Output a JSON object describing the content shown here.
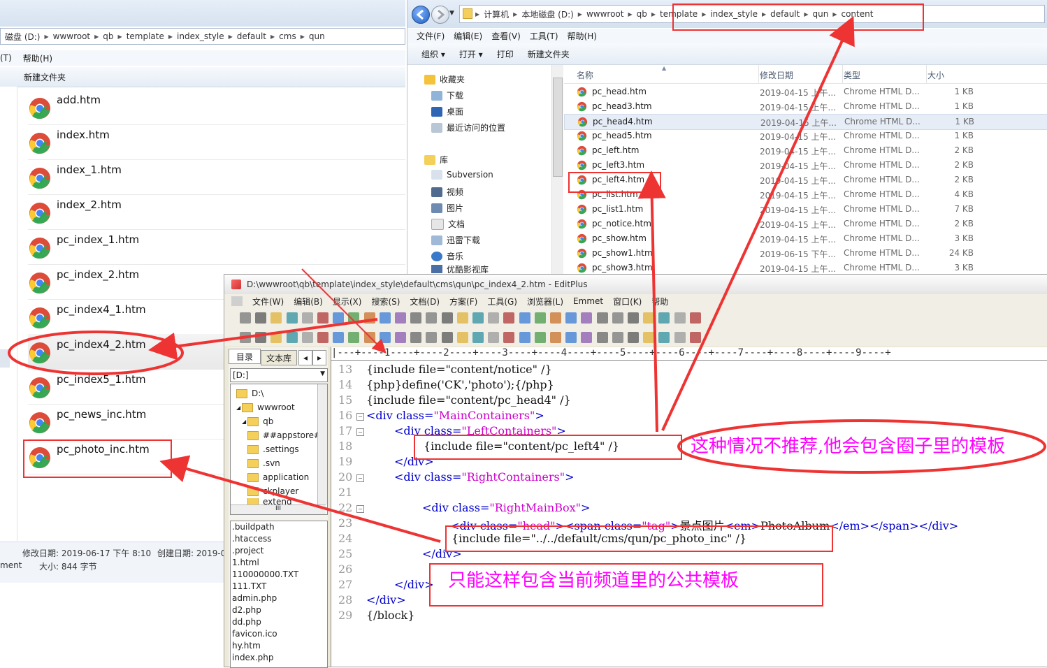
{
  "left_explorer": {
    "breadcrumb": [
      "磁盘 (D:)",
      "wwwroot",
      "qb",
      "template",
      "index_style",
      "default",
      "cms",
      "qun"
    ],
    "menu": [
      "(T)",
      "帮助(H)"
    ],
    "toolbar_new_folder": "新建文件夹",
    "files": [
      "add.htm",
      "index.htm",
      "index_1.htm",
      "index_2.htm",
      "pc_index_1.htm",
      "pc_index_2.htm",
      "pc_index4_1.htm",
      "pc_index4_2.htm",
      "pc_index5_1.htm",
      "pc_news_inc.htm",
      "pc_photo_inc.htm"
    ],
    "status": {
      "modified": "修改日期: 2019-06-17 下午 8:10",
      "created": "创建日期: 2019-0",
      "type": "ment",
      "size": "大小: 844 字节"
    }
  },
  "right_explorer": {
    "breadcrumb": [
      "计算机",
      "本地磁盘 (D:)",
      "wwwroot",
      "qb",
      "template",
      "index_style",
      "default",
      "qun",
      "content"
    ],
    "menu": [
      "文件(F)",
      "编辑(E)",
      "查看(V)",
      "工具(T)",
      "帮助(H)"
    ],
    "toolbar": [
      "组织 ▾",
      "打开 ▾",
      "打印",
      "新建文件夹"
    ],
    "nav": {
      "favorites": "收藏夹",
      "downloads": "下载",
      "desktop": "桌面",
      "recent": "最近访问的位置",
      "libraries": "库",
      "subversion": "Subversion",
      "video": "视频",
      "pictures": "图片",
      "documents": "文档",
      "thunder": "迅雷下载",
      "music": "音乐",
      "partial": "优酷影视库"
    },
    "columns": {
      "name": "名称",
      "date": "修改日期",
      "type": "类型",
      "size": "大小"
    },
    "rows": [
      {
        "name": "pc_head.htm",
        "date": "2019-04-15 上午...",
        "type": "Chrome HTML D...",
        "size": "1 KB"
      },
      {
        "name": "pc_head3.htm",
        "date": "2019-04-15 上午...",
        "type": "Chrome HTML D...",
        "size": "1 KB"
      },
      {
        "name": "pc_head4.htm",
        "date": "2019-04-15 上午...",
        "type": "Chrome HTML D...",
        "size": "1 KB"
      },
      {
        "name": "pc_head5.htm",
        "date": "2019-04-15 上午...",
        "type": "Chrome HTML D...",
        "size": "1 KB"
      },
      {
        "name": "pc_left.htm",
        "date": "2019-04-15 上午...",
        "type": "Chrome HTML D...",
        "size": "2 KB"
      },
      {
        "name": "pc_left3.htm",
        "date": "2019-04-15 上午...",
        "type": "Chrome HTML D...",
        "size": "2 KB"
      },
      {
        "name": "pc_left4.htm",
        "date": "2019-04-15 上午...",
        "type": "Chrome HTML D...",
        "size": "2 KB"
      },
      {
        "name": "pc_list.htm",
        "date": "2019-04-15 上午...",
        "type": "Chrome HTML D...",
        "size": "4 KB"
      },
      {
        "name": "pc_list1.htm",
        "date": "2019-04-15 上午...",
        "type": "Chrome HTML D...",
        "size": "7 KB"
      },
      {
        "name": "pc_notice.htm",
        "date": "2019-04-15 上午...",
        "type": "Chrome HTML D...",
        "size": "2 KB"
      },
      {
        "name": "pc_show.htm",
        "date": "2019-04-15 上午...",
        "type": "Chrome HTML D...",
        "size": "3 KB"
      },
      {
        "name": "pc_show1.htm",
        "date": "2019-06-15 下午...",
        "type": "Chrome HTML D...",
        "size": "24 KB"
      },
      {
        "name": "pc_show3.htm",
        "date": "2019-04-15 上午...",
        "type": "Chrome HTML D...",
        "size": "3 KB"
      }
    ]
  },
  "editplus": {
    "title": "D:\\wwwroot\\qb\\template\\index_style\\default\\cms\\qun\\pc_index4_2.htm - EditPlus",
    "menu": [
      "文件(W)",
      "编辑(B)",
      "显示(X)",
      "搜索(S)",
      "文档(D)",
      "方案(F)",
      "工具(G)",
      "浏览器(L)",
      "Emmet",
      "窗口(K)",
      "帮助"
    ],
    "tabs": {
      "dir": "目录",
      "lib": "文本库"
    },
    "drive": "[D:]",
    "tree": [
      "D:\\",
      "wwwroot",
      "qb",
      "##appstore#",
      ".settings",
      ".svn",
      "application",
      "ckplayer",
      "extend"
    ],
    "file_list": [
      ".buildpath",
      ".htaccess",
      ".project",
      "1.html",
      "110000000.TXT",
      "111.TXT",
      "admin.php",
      "d2.php",
      "dd.php",
      "favicon.ico",
      "hy.htm",
      "index.php"
    ],
    "ruler": "|---+----1----+----2----+----3----+----4----+----5----+----6----+----7----+----8----+----9----+",
    "line_numbers": [
      "13",
      "14",
      "15",
      "16",
      "17",
      "18",
      "19",
      "20",
      "21",
      "22",
      "23",
      "24",
      "25",
      "26",
      "27",
      "28",
      "29"
    ],
    "code": {
      "l13": "{include file=\"content/notice\" /}",
      "l14": "{php}define('CK','photo');{/php}",
      "l15": "{include file=\"content/pc_head4\" /}",
      "l16_tag": "<div",
      "l16_attr": " class=",
      "l16_val": "\"MainContainers\"",
      "l16_end": ">",
      "l17_tag": "<div",
      "l17_attr": " class=",
      "l17_val": "\"LeftContainers\"",
      "l17_end": ">",
      "l18": "{include file=\"content/pc_left4\" /}",
      "l19": "</div>",
      "l20_tag": "<div",
      "l20_attr": " class=",
      "l20_val": "\"RightContainers\"",
      "l20_end": ">",
      "l22_tag": "<div",
      "l22_attr": " class=",
      "l22_val": "\"RightMainBox\"",
      "l22_end": ">",
      "l23_a": "<div",
      "l23_b": " class=",
      "l23_c": "\"head\"",
      "l23_d": "><span",
      "l23_e": " class=",
      "l23_f": "\"tag\"",
      "l23_g": ">",
      "l23_h": "景点图片",
      "l23_i": "<em>",
      "l23_j": "PhotoAlbum",
      "l23_k": "</em></span></div>",
      "l24": "{include file=\"../../default/cms/qun/pc_photo_inc\" /}",
      "l25": "</div>",
      "l27": "</div>",
      "l28": "</div>",
      "l29": "{/block}"
    }
  },
  "annotations": {
    "not_recommended": "这种情况不推荐,他会包含圈子里的模板",
    "only_this_way": "只能这样包含当前频道里的公共模板"
  },
  "colors": {
    "annotation_red": "#e33333",
    "annotation_text": "#ff00ff",
    "keyword": "#0000cc",
    "attr_value": "#cc00cc"
  }
}
